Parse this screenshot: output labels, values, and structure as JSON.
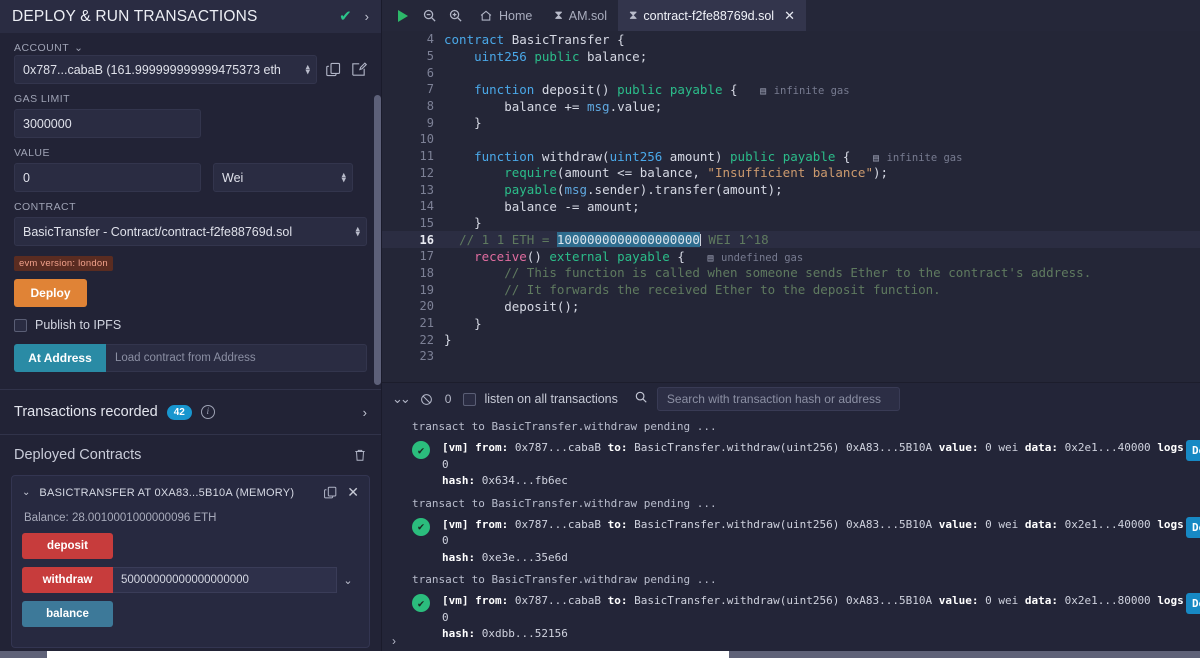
{
  "left_panel": {
    "title": "DEPLOY & RUN TRANSACTIONS",
    "check_icon": "✔",
    "chevron_icon": "›",
    "account": {
      "label": "ACCOUNT",
      "value": "0x787...cabaB (161.999999999999475373 eth",
      "copy_icon": "copy-icon",
      "edit_icon": "edit-icon"
    },
    "gas_limit": {
      "label": "GAS LIMIT",
      "value": "3000000"
    },
    "value": {
      "label": "VALUE",
      "value": "0",
      "unit": "Wei"
    },
    "contract": {
      "label": "CONTRACT",
      "value": "BasicTransfer - Contract/contract-f2fe88769d.sol"
    },
    "evm_badge": "evm version: london",
    "deploy_label": "Deploy",
    "publish_ipfs_label": "Publish to IPFS",
    "at_address_label": "At Address",
    "at_address_placeholder": "Load contract from Address",
    "transactions_recorded": {
      "label": "Transactions recorded",
      "count": "42",
      "info_icon": "i",
      "chevron": "›"
    },
    "deployed_contracts": {
      "label": "Deployed Contracts",
      "trash_icon": "🗑"
    },
    "contract_card": {
      "caret": "⌄",
      "name": "BASICTRANSFER AT 0XA83...5B10A (MEMORY)",
      "copy_icon": "copy-icon",
      "close_icon": "✕",
      "balance": "Balance: 28.0010001000000096 ETH",
      "functions": [
        {
          "name": "deposit",
          "color": "red",
          "input": null
        },
        {
          "name": "withdraw",
          "color": "red",
          "input": "50000000000000000000"
        },
        {
          "name": "balance",
          "color": "blue",
          "input": null
        }
      ]
    }
  },
  "tabbar": {
    "run_icon": "play-icon",
    "zoom_out_icon": "zoom-out-icon",
    "zoom_in_icon": "zoom-in-icon",
    "tabs": [
      {
        "label": "Home",
        "icon": "home-icon",
        "active": false,
        "closable": false
      },
      {
        "label": "AM.sol",
        "icon": "solidity-icon",
        "active": false,
        "closable": false
      },
      {
        "label": "contract-f2fe88769d.sol",
        "icon": "solidity-icon",
        "active": true,
        "closable": true
      }
    ],
    "close_icon": "✕"
  },
  "editor": {
    "first_line": 4,
    "active_line": 16,
    "lines": [
      {
        "n": 4,
        "html": "<span class='k-kw'>contract</span> <span class='k-fn'>BasicTransfer</span> {"
      },
      {
        "n": 5,
        "html": "    <span class='k-kw'>uint256</span> <span class='k-mod'>public</span> balance;"
      },
      {
        "n": 6,
        "html": ""
      },
      {
        "n": 7,
        "html": "    <span class='k-kw'>function</span> deposit() <span class='k-mod'>public</span> <span class='k-mod'>payable</span> {   <span class='gas-glyph'>▤</span> <span class='gas-hint'>infinite gas</span>"
      },
      {
        "n": 8,
        "html": "        balance += <span class='k-blue2'>msg</span>.value;"
      },
      {
        "n": 9,
        "html": "    }"
      },
      {
        "n": 10,
        "html": ""
      },
      {
        "n": 11,
        "html": "    <span class='k-kw'>function</span> withdraw(<span class='k-kw'>uint256</span> amount) <span class='k-mod'>public</span> <span class='k-mod'>payable</span> {   <span class='gas-glyph'>▤</span> <span class='gas-hint'>infinite gas</span>"
      },
      {
        "n": 12,
        "html": "        <span class='k-teal'>require</span>(amount &lt;= balance, <span class='k-str'>\"Insufficient balance\"</span>);"
      },
      {
        "n": 13,
        "html": "        <span class='k-teal'>payable</span>(<span class='k-blue2'>msg</span>.sender).transfer(amount);"
      },
      {
        "n": 14,
        "html": "        balance -= amount;"
      },
      {
        "n": 15,
        "html": "    }"
      },
      {
        "n": 16,
        "html": "  <span class='k-cmt'>// 1 1 ETH = </span><span class='hl-sel'>1000000000000000000</span><span class='cursor-bar'></span><span class='k-cmt'> WEI 1^18</span>"
      },
      {
        "n": 17,
        "html": "    <span class='k-pink'>receive</span>() <span class='k-mod'>external</span> <span class='k-mod'>payable</span> {   <span class='gas-glyph'>▤</span> <span class='gas-hint'>undefined gas</span>"
      },
      {
        "n": 18,
        "html": "        <span class='k-cmt'>// This function is called when someone sends Ether to the contract's address.</span>"
      },
      {
        "n": 19,
        "html": "        <span class='k-cmt'>// It forwards the received Ether to the deposit function.</span>"
      },
      {
        "n": 20,
        "html": "        deposit();"
      },
      {
        "n": 21,
        "html": "    }"
      },
      {
        "n": 22,
        "html": "}"
      },
      {
        "n": 23,
        "html": ""
      }
    ]
  },
  "terminal": {
    "collapse_icon": "⌄⌄",
    "clear_icon": "🚫",
    "pending_count": "0",
    "listen_label": "listen on all transactions",
    "search_icon": "search-icon",
    "search_placeholder": "Search with transaction hash or address",
    "entries": [
      {
        "type": "plain",
        "text": "transact to BasicTransfer.withdraw pending ..."
      },
      {
        "type": "tx",
        "status_icon": "✔",
        "line1": "[vm] from: 0x787...cabaB to: BasicTransfer.withdraw(uint256) 0xA83...5B10A value: 0 wei data: 0x2e1...40000 logs: 0",
        "line2": "hash: 0x634...fb6ec",
        "debug_label": "Debug"
      },
      {
        "type": "plain",
        "text": "transact to BasicTransfer.withdraw pending ..."
      },
      {
        "type": "tx",
        "status_icon": "✔",
        "line1": "[vm] from: 0x787...cabaB to: BasicTransfer.withdraw(uint256) 0xA83...5B10A value: 0 wei data: 0x2e1...40000 logs: 0",
        "line2": "hash: 0xe3e...35e6d",
        "debug_label": "Debug"
      },
      {
        "type": "plain",
        "text": "transact to BasicTransfer.withdraw pending ..."
      },
      {
        "type": "tx",
        "status_icon": "✔",
        "line1": "[vm] from: 0x787...cabaB to: BasicTransfer.withdraw(uint256) 0xA83...5B10A value: 0 wei data: 0x2e1...80000 logs: 0",
        "line2": "hash: 0xdbb...52156",
        "debug_label": "Debug"
      }
    ],
    "prompt_caret": "›"
  },
  "colors": {
    "background": "#222336",
    "panel_header": "#2a2c42",
    "accent_orange": "#e08336",
    "accent_teal": "#2a8ba5",
    "accent_red": "#c73c3c",
    "accent_blue": "#1789c4",
    "success_green": "#2bbd7d",
    "badge_blue": "#1896cf"
  }
}
